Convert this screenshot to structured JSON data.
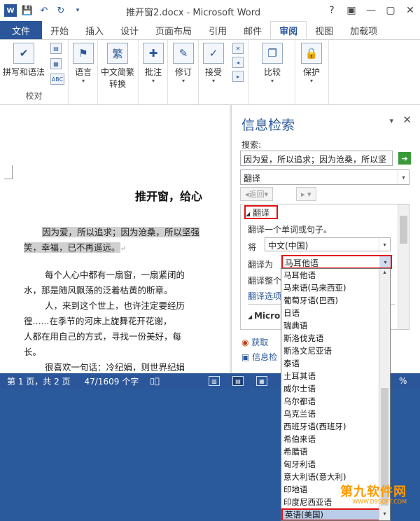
{
  "window": {
    "title": "推开窗2.docx - Microsoft Word",
    "buttons": [
      "?",
      "▣",
      "—",
      "▢",
      "✕"
    ]
  },
  "tabs": [
    {
      "label": "文件"
    },
    {
      "label": "开始"
    },
    {
      "label": "插入"
    },
    {
      "label": "设计"
    },
    {
      "label": "页面布局"
    },
    {
      "label": "引用"
    },
    {
      "label": "邮件"
    },
    {
      "label": "审阅"
    },
    {
      "label": "视图"
    },
    {
      "label": "加载项"
    }
  ],
  "ribbon": {
    "spelling": "拼写和语法",
    "abc_label": "ABC",
    "group_proofing": "校对",
    "language": "语言",
    "chinese_convert": "中文简繁",
    "chinese_convert2": "转换",
    "comment": "批注",
    "track": "修订",
    "accept": "接受",
    "compare": "比较",
    "protect": "保护"
  },
  "document": {
    "title": "推开窗，给心",
    "lines": [
      "因为爱，所以追求；因为沧桑，所以坚强",
      "笑，幸福，已不再遥远。",
      "每个人心中都有一扇窗，一扇紧闭的",
      "水，那是随风飘荡的泛着枯黄的断章。",
      "人，来到这个世上，也许注定要经历",
      "徨......在季节的河床上旋舞花开花谢，",
      "人都在用自己的方式，寻找一份美好，每",
      "长。",
      "很喜欢一句话：冷纪娟，则世界纪娟"
    ]
  },
  "pane": {
    "title": "信息检索",
    "search_label": "搜索:",
    "search_value": "因为爱，所以追求；因为沧桑，所以坚",
    "service": "翻译",
    "back": "返回",
    "section_header": "翻译",
    "desc": "翻译一个单词或句子。",
    "from_label": "将",
    "from_value": "中文(中国)",
    "to_label": "翻译为",
    "to_value": "马耳他语",
    "translate_doc": "翻译整个",
    "options_link": "翻译选项",
    "micro_label": "Micro",
    "get_link": "获取",
    "info_link": "信息检"
  },
  "dropdown": {
    "options": [
      "马耳他语",
      "马来语(马来西亚)",
      "葡萄牙语(巴西)",
      "日语",
      "瑞典语",
      "斯洛伐克语",
      "斯洛文尼亚语",
      "泰语",
      "土耳其语",
      "威尔士语",
      "乌尔都语",
      "乌克兰语",
      "西班牙语(西班牙)",
      "希伯来语",
      "希腊语",
      "匈牙利语",
      "意大利语(意大利)",
      "印地语",
      "印度尼西亚语",
      "英语(美国)"
    ],
    "selected": "英语(美国)"
  },
  "status": {
    "page": "第 1 页，共 2 页",
    "words": "47/1609 个字",
    "zoom_suffix": "%"
  },
  "watermark": {
    "line1": "第九软件网",
    "line2": "WWW.D9SOFT.COM"
  }
}
